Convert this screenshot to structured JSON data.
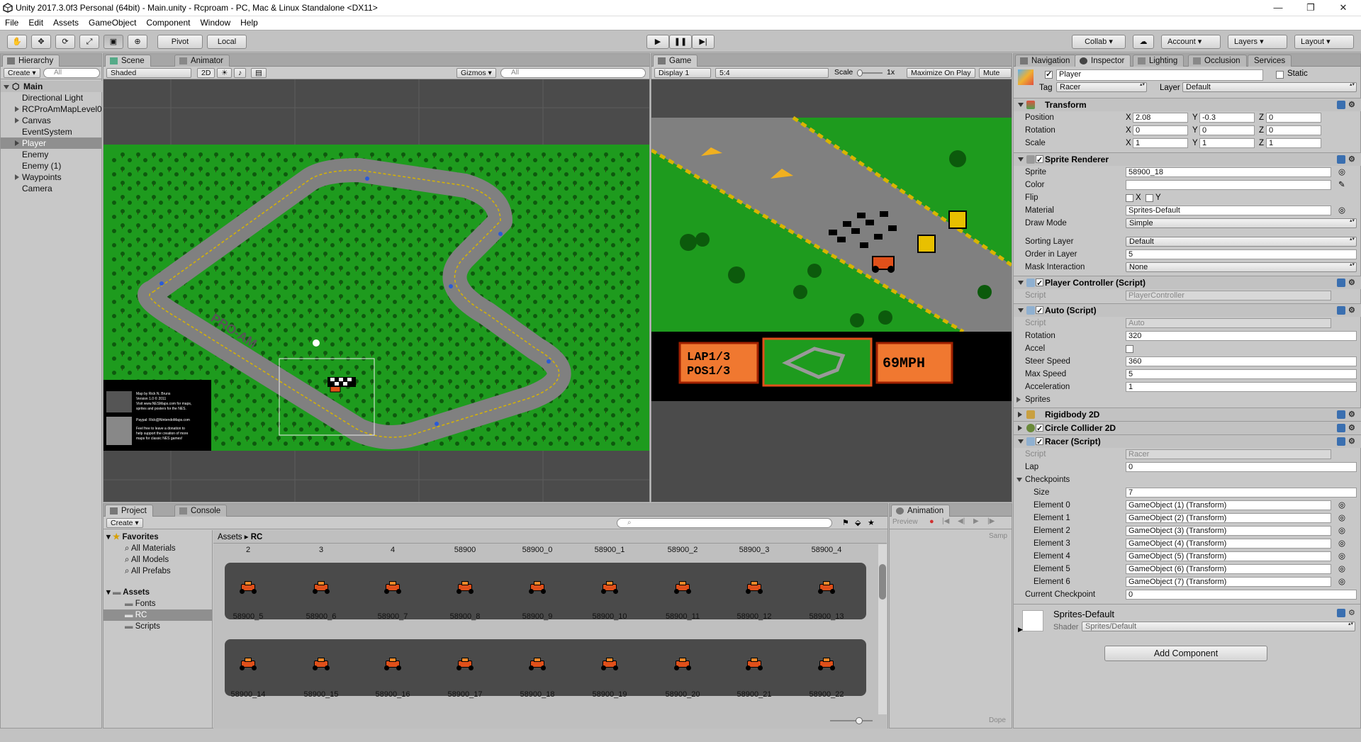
{
  "window": {
    "title": "Unity 2017.3.0f3 Personal (64bit) - Main.unity - Rcproam - PC, Mac & Linux Standalone <DX11>",
    "minimize": "—",
    "maximize": "❐",
    "close": "✕"
  },
  "menu": [
    "File",
    "Edit",
    "Assets",
    "GameObject",
    "Component",
    "Window",
    "Help"
  ],
  "toolbar": {
    "pivot": "Pivot",
    "local": "Local",
    "collab": "Collab ▾",
    "account": "Account",
    "layers": "Layers",
    "layout": "Layout"
  },
  "hierarchy": {
    "tab": "Hierarchy",
    "create": "Create ▾",
    "search": "All",
    "scene": "Main",
    "items": [
      "Directional Light",
      "RCProAmMapLevel0",
      "Canvas",
      "EventSystem",
      "Player",
      "Enemy",
      "Enemy (1)",
      "Waypoints",
      "Camera"
    ]
  },
  "scene": {
    "tab": "Scene",
    "tab2": "Animator",
    "shaded": "Shaded",
    "mode2d": "2D",
    "gizmos": "Gizmos ▾",
    "search": "All",
    "track_text": "PRO-AM",
    "info_lines": [
      "Map by Rick N. Bruns",
      "Version 1.0 © 2011",
      "Visit www.NESMaps.com for maps,",
      "sprites and posters for the NES.",
      "Paypal: Rick@NintendoMaps.com",
      "Feel free to leave a donation to",
      "help support the creation of more",
      "maps for classic NES games!"
    ]
  },
  "game": {
    "tab": "Game",
    "display": "Display 1",
    "aspect": "5:4",
    "scale_label": "Scale",
    "scale_value": "1x",
    "maximize": "Maximize On Play",
    "mute": "Mute Audio",
    "hud": {
      "lap": "LAP1/3",
      "pos": "POS1/3",
      "speed": "69MPH"
    }
  },
  "inspector": {
    "tabs": [
      "Navigation",
      "Inspector",
      "Lighting",
      "Occlusion",
      "Services"
    ],
    "name": "Player",
    "static": "Static",
    "tag_label": "Tag",
    "tag": "Racer",
    "layer_label": "Layer",
    "layer": "Default",
    "transform": {
      "title": "Transform",
      "position": "Position",
      "rotation": "Rotation",
      "scale": "Scale",
      "px": "2.08",
      "py": "-0.3",
      "pz": "0",
      "rx": "0",
      "ry": "0",
      "rz": "0",
      "sx": "1",
      "sy": "1",
      "sz": "1",
      "xl": "X",
      "yl": "Y",
      "zl": "Z"
    },
    "sprite_renderer": {
      "title": "Sprite Renderer",
      "sprite_l": "Sprite",
      "sprite": "58900_18",
      "color_l": "Color",
      "flip_l": "Flip",
      "flipx": "X",
      "flipy": "Y",
      "material_l": "Material",
      "material": "Sprites-Default",
      "draw_l": "Draw Mode",
      "draw": "Simple",
      "sorting_l": "Sorting Layer",
      "sorting": "Default",
      "order_l": "Order in Layer",
      "order": "5",
      "mask_l": "Mask Interaction",
      "mask": "None"
    },
    "player_controller": {
      "title": "Player Controller (Script)",
      "script_l": "Script",
      "script": "PlayerController"
    },
    "auto": {
      "title": "Auto (Script)",
      "script_l": "Script",
      "script": "Auto",
      "rotation_l": "Rotation",
      "rotation": "320",
      "accel_l": "Accel",
      "steer_l": "Steer Speed",
      "steer": "360",
      "max_l": "Max Speed",
      "max": "5",
      "acc_l": "Acceleration",
      "acc": "1",
      "sprites_l": "Sprites"
    },
    "rigidbody": {
      "title": "Rigidbody 2D"
    },
    "collider": {
      "title": "Circle Collider 2D"
    },
    "racer": {
      "title": "Racer (Script)",
      "script_l": "Script",
      "script": "Racer",
      "lap_l": "Lap",
      "lap": "0",
      "checkpoints_l": "Checkpoints",
      "size_l": "Size",
      "size": "7",
      "elements": [
        {
          "l": "Element 0",
          "v": "GameObject (1) (Transform)"
        },
        {
          "l": "Element 1",
          "v": "GameObject (2) (Transform)"
        },
        {
          "l": "Element 2",
          "v": "GameObject (3) (Transform)"
        },
        {
          "l": "Element 3",
          "v": "GameObject (4) (Transform)"
        },
        {
          "l": "Element 4",
          "v": "GameObject (5) (Transform)"
        },
        {
          "l": "Element 5",
          "v": "GameObject (6) (Transform)"
        },
        {
          "l": "Element 6",
          "v": "GameObject (7) (Transform)"
        }
      ],
      "current_l": "Current Checkpoint",
      "current": "0"
    },
    "material": {
      "name": "Sprites-Default",
      "shader_l": "Shader",
      "shader": "Sprites/Default"
    },
    "add_component": "Add Component"
  },
  "project": {
    "tab": "Project",
    "tab2": "Console",
    "create": "Create ▾",
    "favorites": "Favorites",
    "fav_items": [
      "All Materials",
      "All Models",
      "All Prefabs"
    ],
    "assets": "Assets",
    "asset_items": [
      "Fonts",
      "RC",
      "Scripts"
    ],
    "breadcrumb": [
      "Assets",
      "RC"
    ],
    "row0": [
      "2",
      "3",
      "4",
      "58900",
      "58900_0",
      "58900_1",
      "58900_2",
      "58900_3",
      "58900_4"
    ],
    "row1": [
      "58900_5",
      "58900_6",
      "58900_7",
      "58900_8",
      "58900_9",
      "58900_10",
      "58900_11",
      "58900_12",
      "58900_13"
    ],
    "row2": [
      "58900_14",
      "58900_15",
      "58900_16",
      "58900_17",
      "58900_18",
      "58900_19",
      "58900_20",
      "58900_21",
      "58900_22"
    ]
  },
  "animation": {
    "tab": "Animation",
    "preview": "Preview",
    "samples": "Samp",
    "dope": "Dope"
  },
  "colors": {
    "grass": "#1e9b1e",
    "track": "#808080",
    "hud_orange": "#e0501a",
    "selection": "#8f8f8f"
  }
}
